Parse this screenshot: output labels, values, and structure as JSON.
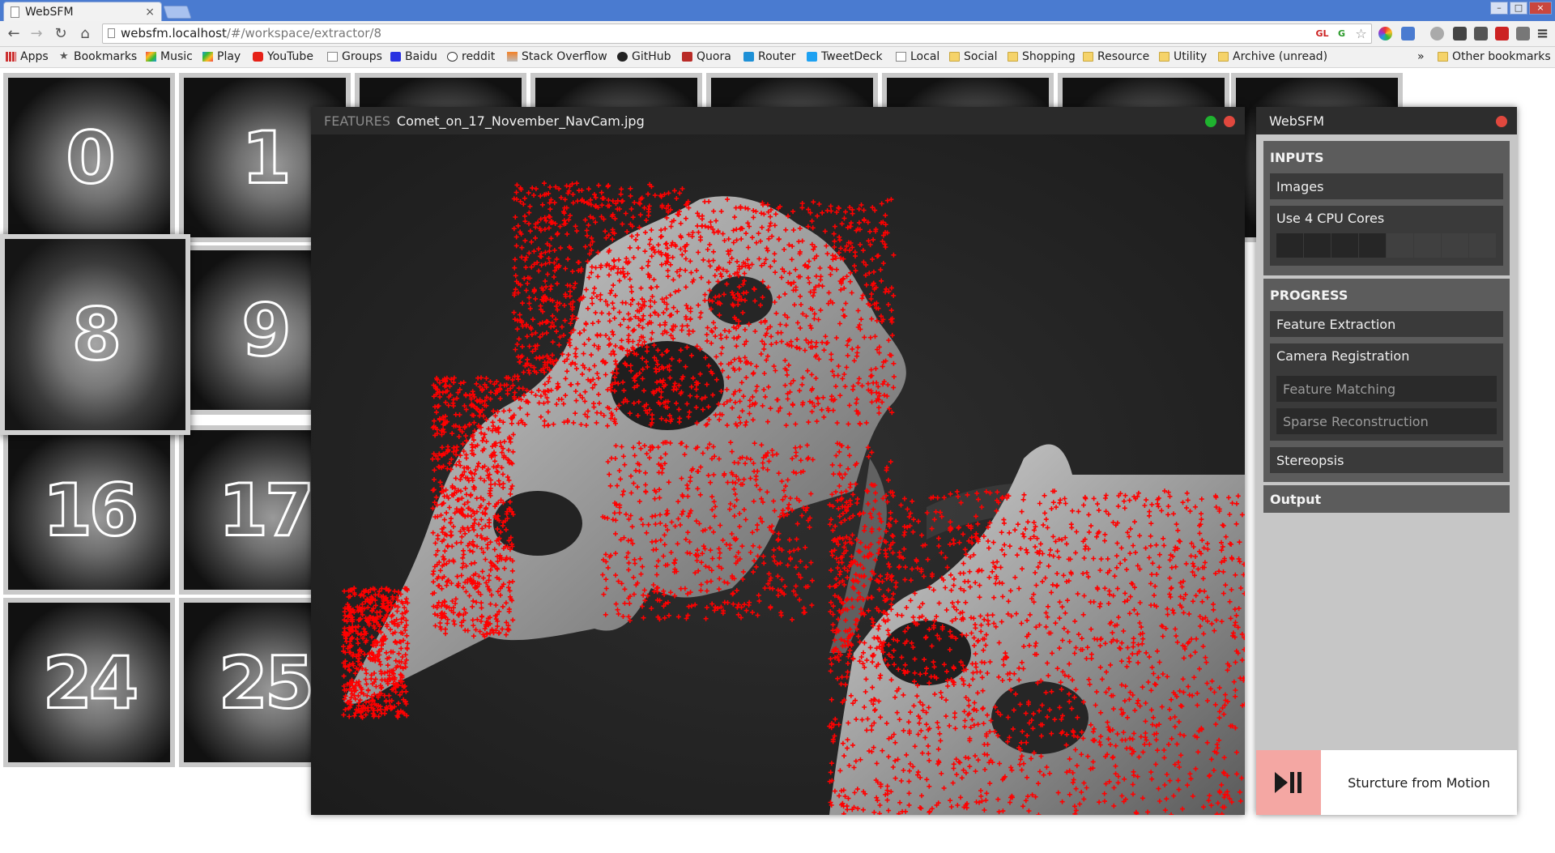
{
  "browser": {
    "tab_title": "WebSFM",
    "tab_close": "×",
    "url_host": "websfm.localhost",
    "url_path": "/#/workspace/extractor/8",
    "window_controls": [
      "–",
      "□",
      "×"
    ],
    "nav": {
      "back": "←",
      "forward": "→",
      "reload": "↻",
      "home": "⌂",
      "menu": "≡",
      "star": "☆"
    },
    "extensions": [
      "GL",
      "G"
    ]
  },
  "bookmarks": {
    "items": [
      "Apps",
      "Bookmarks",
      "Music",
      "Play",
      "YouTube",
      "Groups",
      "Baidu",
      "reddit",
      "Stack Overflow",
      "GitHub",
      "Quora",
      "Router",
      "TweetDeck",
      "Local",
      "Social",
      "Shopping",
      "Resource",
      "Utility",
      "Archive (unread)"
    ],
    "overflow": "»",
    "other": "Other bookmarks"
  },
  "thumbnails": [
    "0",
    "1",
    "8",
    "9",
    "16",
    "17",
    "24",
    "25"
  ],
  "features_window": {
    "label": "FEATURES",
    "filename": "Comet_on_17_November_NavCam.jpg",
    "colors": {
      "feature_marker": "#ff0000",
      "maximize": "#1fb32f",
      "close": "#e0483e"
    }
  },
  "panel": {
    "title": "WebSFM",
    "inputs": {
      "header": "INPUTS",
      "images": "Images",
      "cpu_cores": "Use 4 CPU Cores",
      "cores_total": 8,
      "cores_enabled": 4
    },
    "progress": {
      "header": "PROGRESS",
      "feature_extraction": "Feature Extraction",
      "camera_registration": "Camera Registration",
      "feature_matching": "Feature Matching",
      "sparse_reconstruction": "Sparse Reconstruction",
      "stereopsis": "Stereopsis"
    },
    "output": {
      "header": "Output"
    },
    "footer": {
      "play_pause": "▶❙❙",
      "label": "Sturcture from Motion"
    },
    "colors": {
      "play_bg": "#f4a7a3",
      "close": "#e0483e"
    }
  }
}
